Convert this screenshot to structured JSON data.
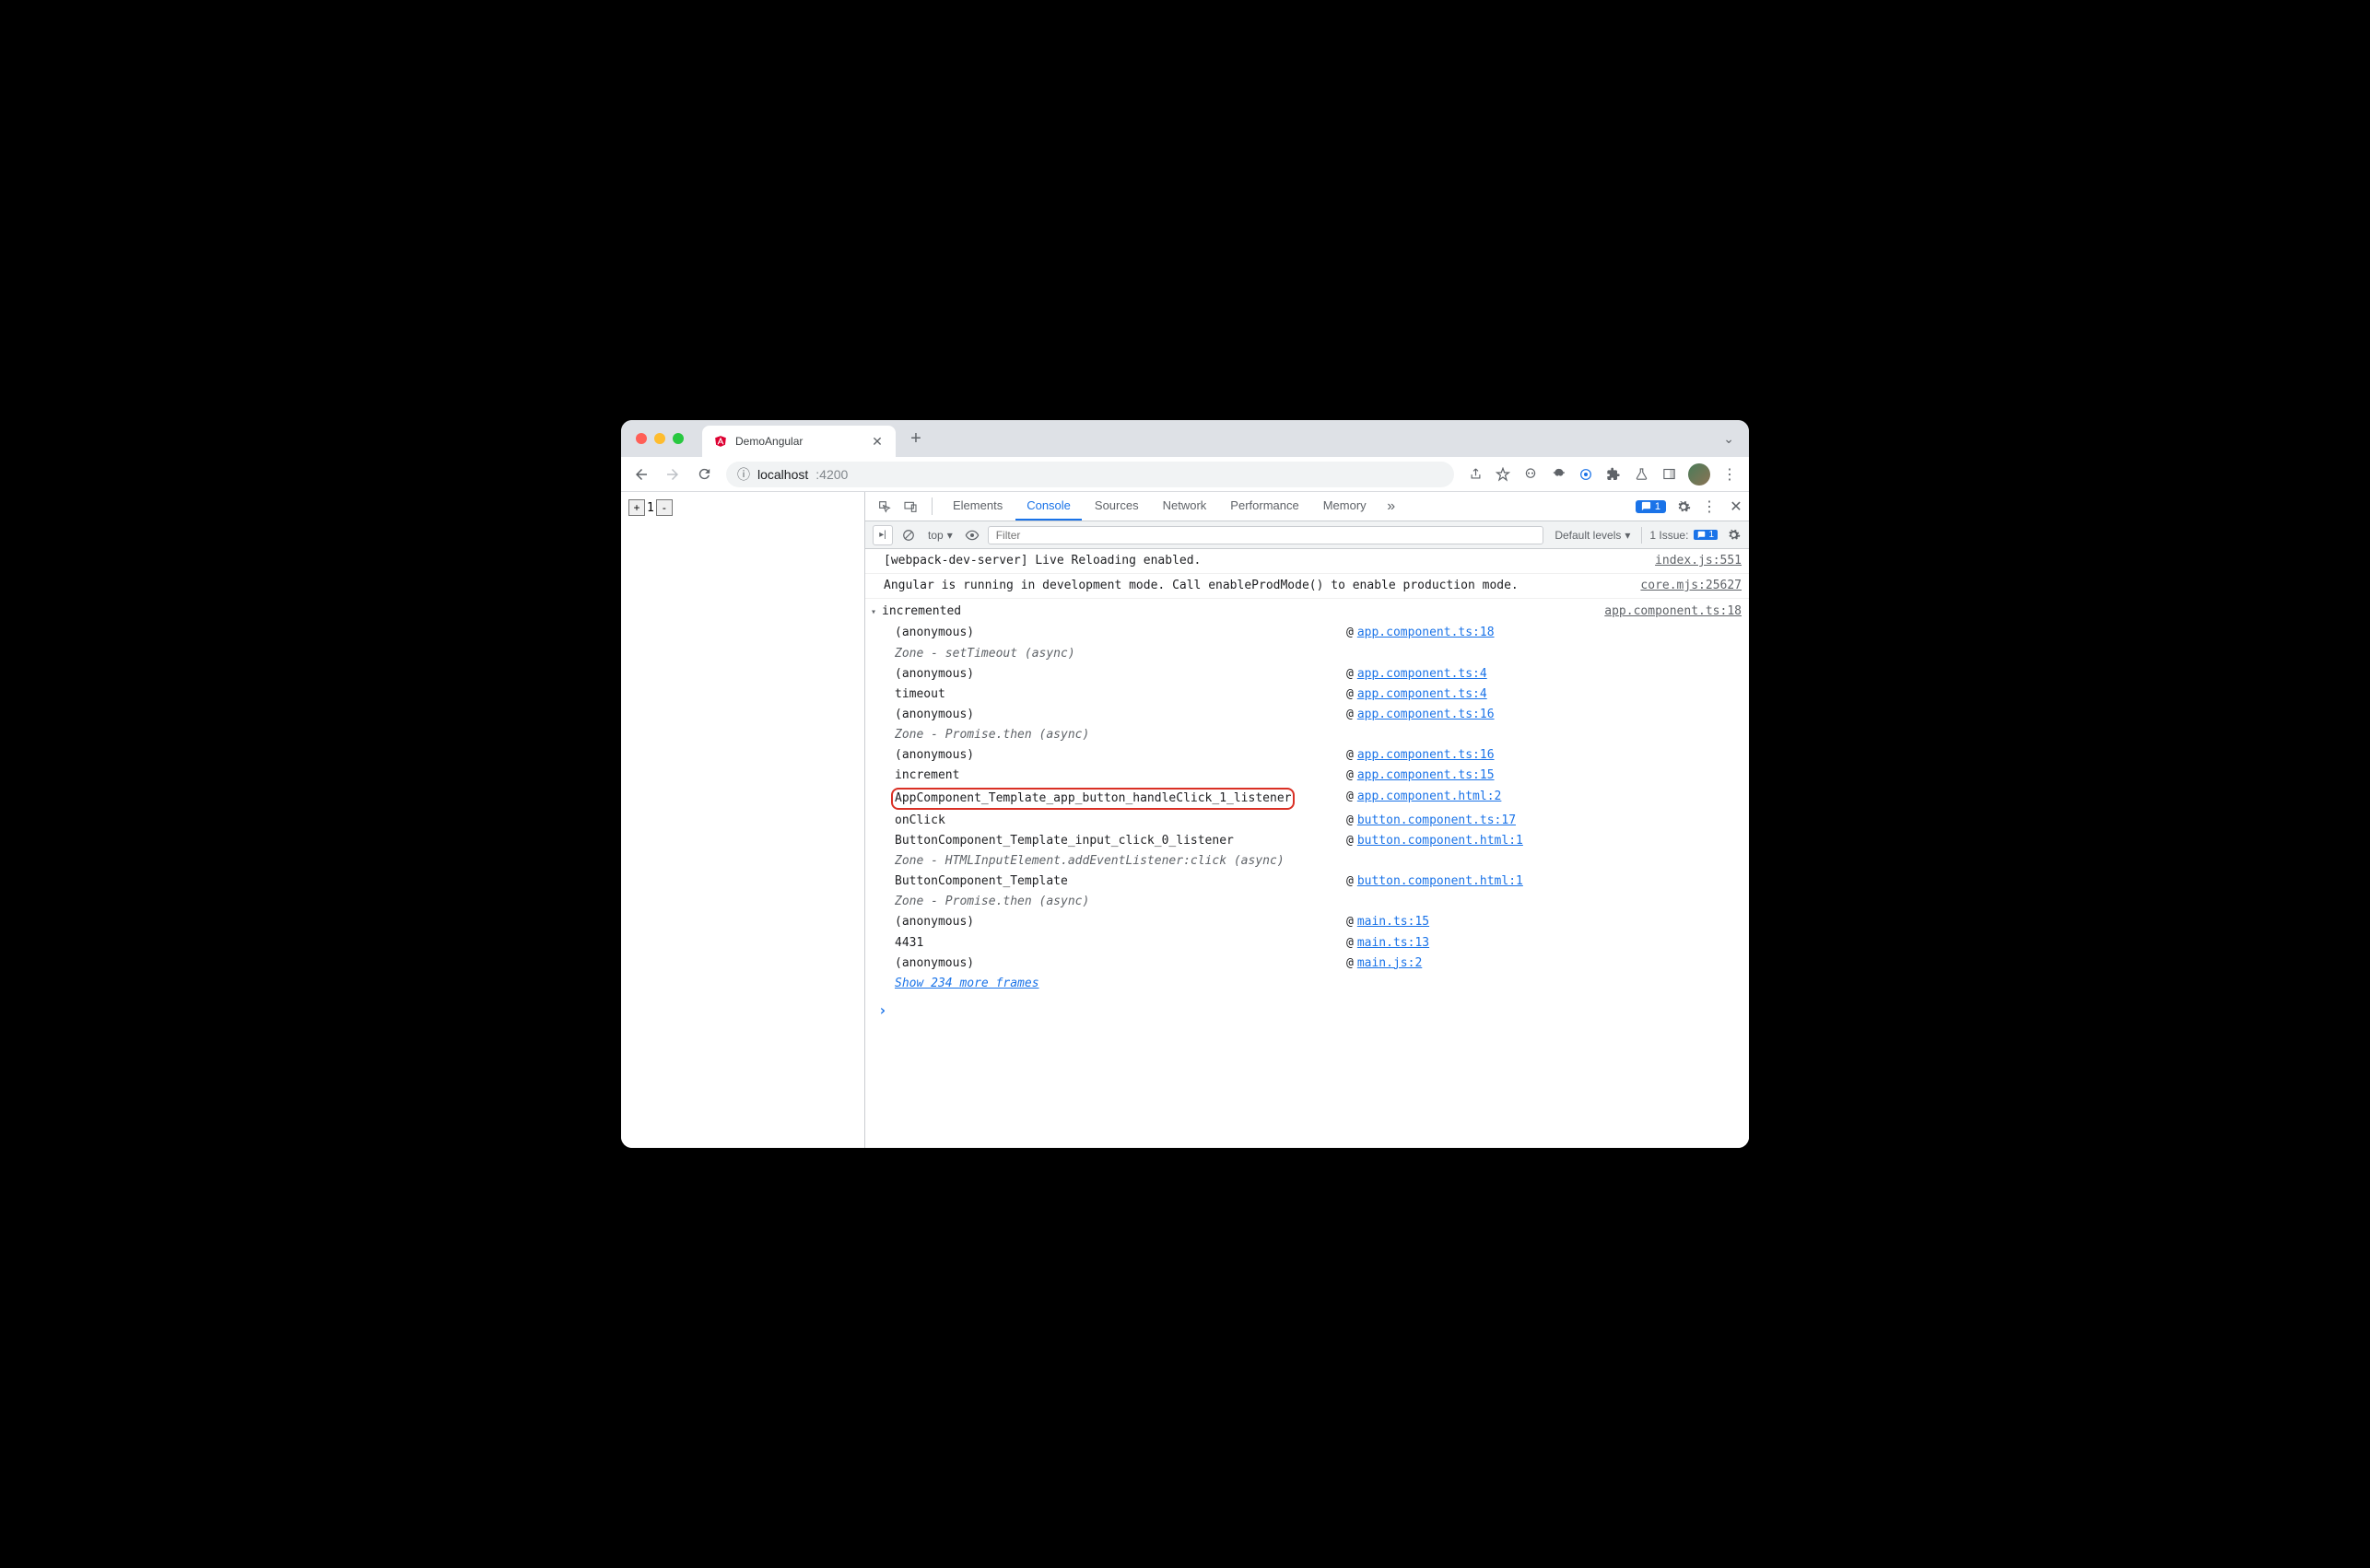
{
  "tab": {
    "title": "DemoAngular"
  },
  "url": {
    "host": "localhost",
    "port": ":4200"
  },
  "page": {
    "counter_value": "1"
  },
  "devtools": {
    "tabs": {
      "elements": "Elements",
      "console": "Console",
      "sources": "Sources",
      "network": "Network",
      "performance": "Performance",
      "memory": "Memory"
    },
    "badge_count": "1",
    "console_bar": {
      "context": "top",
      "filter_placeholder": "Filter",
      "levels": "Default levels",
      "issue_prefix": "1 Issue:",
      "issue_count": "1"
    }
  },
  "logs": {
    "l1": {
      "msg": "[webpack-dev-server] Live Reloading enabled.",
      "src": "index.js:551"
    },
    "l2": {
      "msg": "Angular is running in development mode. Call enableProdMode() to enable production mode.",
      "src": "core.mjs:25627"
    },
    "trace": {
      "title": "incremented",
      "head_src": "app.component.ts:18",
      "frames": {
        "f1": {
          "name": "(anonymous)",
          "link": "app.component.ts:18"
        },
        "z1": {
          "name": "Zone - setTimeout (async)"
        },
        "f2": {
          "name": "(anonymous)",
          "link": "app.component.ts:4"
        },
        "f3": {
          "name": "timeout",
          "link": "app.component.ts:4"
        },
        "f4": {
          "name": "(anonymous)",
          "link": "app.component.ts:16"
        },
        "z2": {
          "name": "Zone - Promise.then (async)"
        },
        "f5": {
          "name": "(anonymous)",
          "link": "app.component.ts:16"
        },
        "f6": {
          "name": "increment",
          "link": "app.component.ts:15"
        },
        "f7": {
          "name": "AppComponent_Template_app_button_handleClick_1_listener",
          "link": "app.component.html:2"
        },
        "f8": {
          "name": "onClick",
          "link": "button.component.ts:17"
        },
        "f9": {
          "name": "ButtonComponent_Template_input_click_0_listener",
          "link": "button.component.html:1"
        },
        "z3": {
          "name": "Zone - HTMLInputElement.addEventListener:click (async)"
        },
        "f10": {
          "name": "ButtonComponent_Template",
          "link": "button.component.html:1"
        },
        "z4": {
          "name": "Zone - Promise.then (async)"
        },
        "f11": {
          "name": "(anonymous)",
          "link": "main.ts:15"
        },
        "f12": {
          "name": "4431",
          "link": "main.ts:13"
        },
        "f13": {
          "name": "(anonymous)",
          "link": "main.js:2"
        }
      },
      "more": "Show 234 more frames"
    },
    "at_symbol": "@"
  }
}
